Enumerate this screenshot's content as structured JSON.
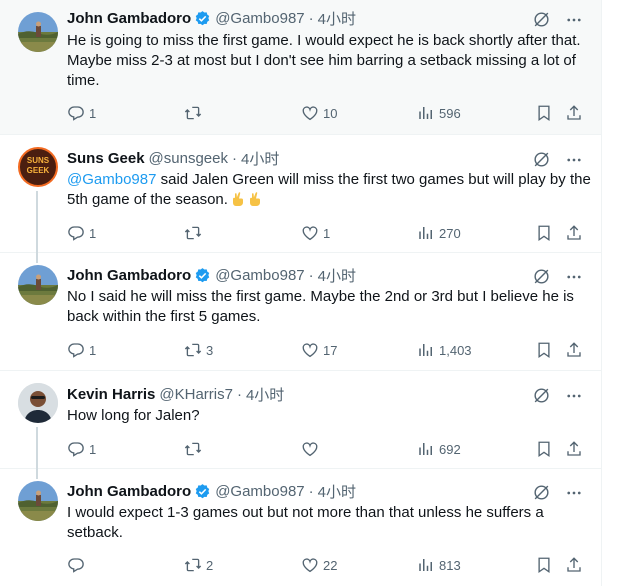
{
  "tweets": [
    {
      "name": "John Gambadoro",
      "verified": true,
      "handle": "@Gambo987",
      "time": "4小时",
      "text": "He is going to miss the first game. I would expect he is back shortly after that. Maybe miss 2-3 at most but I don't see him barring a setback missing a lot of time.",
      "replies": "1",
      "retweets": "",
      "likes": "10",
      "views": "596",
      "avatar_icon": "landscape-avatar"
    },
    {
      "name": "Suns Geek",
      "verified": false,
      "handle": "@sunsgeek",
      "time": "4小时",
      "mention": "@Gambo987",
      "text": " said Jalen Green will miss the first two games but will play by the 5th game of the season.",
      "replies": "1",
      "retweets": "",
      "likes": "1",
      "views": "270",
      "avatar_text": "SUNS GEEK",
      "emoji_icon": "crossed-fingers-emoji"
    },
    {
      "name": "John Gambadoro",
      "verified": true,
      "handle": "@Gambo987",
      "time": "4小时",
      "text": "No I said he will miss the first game. Maybe the 2nd or 3rd but I believe he is back within the first 5 games.",
      "replies": "1",
      "retweets": "3",
      "likes": "17",
      "views": "1,403"
    },
    {
      "name": "Kevin Harris",
      "verified": false,
      "handle": "@KHarris7",
      "time": "4小时",
      "text": "How long for Jalen?",
      "replies": "1",
      "retweets": "",
      "likes": "",
      "views": "692"
    },
    {
      "name": "John Gambadoro",
      "verified": true,
      "handle": "@Gambo987",
      "time": "4小时",
      "text": "I would expect 1-3 games out but not more than that unless he suffers a setback.",
      "replies": "",
      "retweets": "2",
      "likes": "22",
      "views": "813"
    }
  ],
  "separator": "·",
  "colors": {
    "accent": "#1d9bf0",
    "muted": "#536471",
    "text": "#0f1419",
    "highlight_bg": "#f7f9f9",
    "avatar_ring": "#f26a21"
  }
}
